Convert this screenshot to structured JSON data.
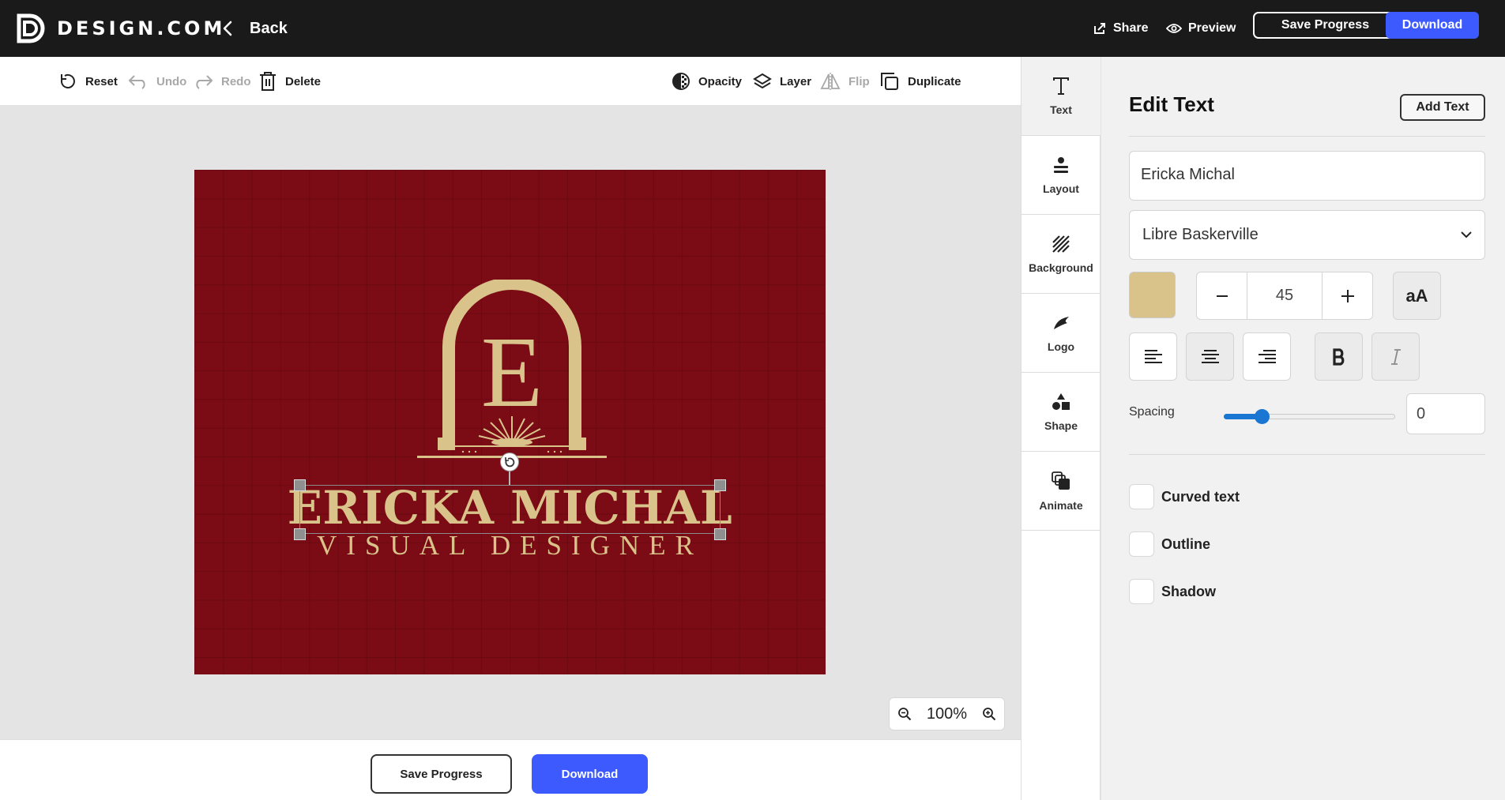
{
  "brand": {
    "name": "DESIGN.COM"
  },
  "topbar": {
    "back_label": "Back",
    "share_label": "Share",
    "preview_label": "Preview",
    "save_progress_label": "Save Progress",
    "download_label": "Download"
  },
  "toolbar": {
    "reset": "Reset",
    "undo": "Undo",
    "redo": "Redo",
    "delete": "Delete",
    "opacity": "Opacity",
    "layer": "Layer",
    "flip": "Flip",
    "duplicate": "Duplicate"
  },
  "canvas": {
    "background_color": "#7b0b15",
    "accent_color": "#d9c38b",
    "emblem_letter": "E",
    "name_text": "ERICKA MICHAL",
    "subtitle_text": "VISUAL DESIGNER"
  },
  "zoom": {
    "value": "100%"
  },
  "bottombar": {
    "save_progress_label": "Save Progress",
    "download_label": "Download"
  },
  "rail": {
    "items": [
      {
        "label": "Text",
        "icon": "text-icon"
      },
      {
        "label": "Layout",
        "icon": "layout-icon"
      },
      {
        "label": "Background",
        "icon": "background-icon"
      },
      {
        "label": "Logo",
        "icon": "logo-icon"
      },
      {
        "label": "Shape",
        "icon": "shape-icon"
      },
      {
        "label": "Animate",
        "icon": "animate-icon"
      }
    ]
  },
  "panel": {
    "title": "Edit Text",
    "add_text_label": "Add Text",
    "text_value": "Ericka Michal",
    "font_family": "Libre Baskerville",
    "color": "#d9c38b",
    "font_size": "45",
    "case_label": "aA",
    "spacing_label": "Spacing",
    "spacing_value": "0",
    "options": {
      "curved": "Curved text",
      "outline": "Outline",
      "shadow": "Shadow"
    }
  },
  "colors": {
    "primary": "#3d5afe",
    "topbar": "#1a1a1a",
    "slider": "#1976d2"
  }
}
